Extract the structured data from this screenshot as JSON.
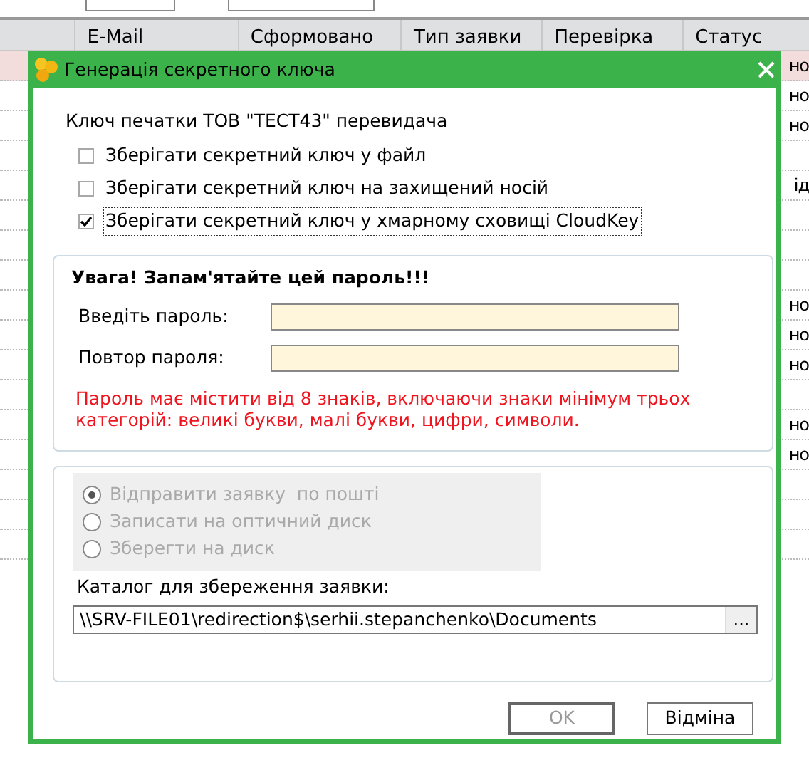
{
  "background": {
    "columns": [
      "E-Mail",
      "Сформовано",
      "Тип заявки",
      "Перевірка",
      "Статус"
    ],
    "rows": [
      {
        "selected": true,
        "column_5": "но"
      },
      {
        "selected": false,
        "column_5": "но"
      },
      {
        "selected": false,
        "column_5": "но"
      },
      {
        "selected": false
      },
      {
        "selected": false,
        "column_5": "ід"
      },
      {
        "selected": false
      },
      {
        "selected": false
      },
      {
        "selected": false
      },
      {
        "selected": false,
        "column_5": "но"
      },
      {
        "selected": false,
        "column_5": "но"
      },
      {
        "selected": false,
        "column_5": "но"
      },
      {
        "selected": false
      },
      {
        "selected": false,
        "column_5": "но"
      },
      {
        "selected": false,
        "column_5": "но"
      },
      {
        "selected": false
      },
      {
        "selected": false
      },
      {
        "selected": false
      }
    ]
  },
  "dialog": {
    "title": "Генерація секретного ключа",
    "subtitle": "Ключ печатки ТОВ \"ТЕСТ43\" перевидача",
    "checkboxes": [
      {
        "label": "Зберігати секретний ключ у файл",
        "checked": false,
        "focused": false
      },
      {
        "label": "Зберігати секретний ключ на захищений носій",
        "checked": false,
        "focused": false
      },
      {
        "label": "Зберігати секретний ключ у хмарному сховищі CloudKey",
        "checked": true,
        "focused": true
      }
    ],
    "password_group": {
      "warning": "Увага! Запам'ятайте цей пароль!!!",
      "fields": [
        {
          "label": "Введіть пароль:"
        },
        {
          "label": "Повтор пароля:"
        }
      ],
      "hint": "Пароль має містити від 8 знаків, включаючи знаки мінімум трьох категорій: великі букви, малі букви, цифри, символи."
    },
    "delivery": {
      "disabled": true,
      "options": [
        {
          "label": "Відправити заявку  по пошті",
          "selected": true
        },
        {
          "label": "Записати на оптичний диск",
          "selected": false
        },
        {
          "label": "Зберегти на диск",
          "selected": false
        }
      ]
    },
    "directory": {
      "label": "Каталог для збереження заявки:",
      "value": "\\\\SRV-FILE01\\redirection$\\serhii.stepanchenko\\Documents",
      "browse_button": "..."
    },
    "buttons": [
      {
        "label": "OK",
        "disabled": true
      },
      {
        "label": "Відміна",
        "disabled": false
      }
    ]
  }
}
